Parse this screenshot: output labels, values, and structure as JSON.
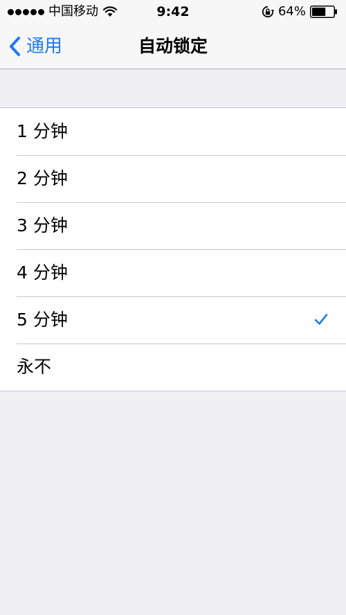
{
  "status_bar": {
    "carrier": "中国移动",
    "time": "9:42",
    "battery_percent": "64%",
    "battery_level": 0.64
  },
  "nav": {
    "back_label": "通用",
    "title": "自动锁定"
  },
  "options": [
    {
      "label": "1 分钟",
      "selected": false
    },
    {
      "label": "2 分钟",
      "selected": false
    },
    {
      "label": "3 分钟",
      "selected": false
    },
    {
      "label": "4 分钟",
      "selected": false
    },
    {
      "label": "5 分钟",
      "selected": true
    },
    {
      "label": "永不",
      "selected": false
    }
  ],
  "colors": {
    "accent": "#1a7cf2",
    "background": "#efeff4",
    "bar_background": "#f7f7f8",
    "separator": "#c8c7cc"
  },
  "icons": {
    "back": "chevron-left-icon",
    "selected": "checkmark-icon",
    "wifi": "wifi-icon",
    "rotation_lock": "rotation-lock-icon",
    "battery": "battery-icon"
  }
}
